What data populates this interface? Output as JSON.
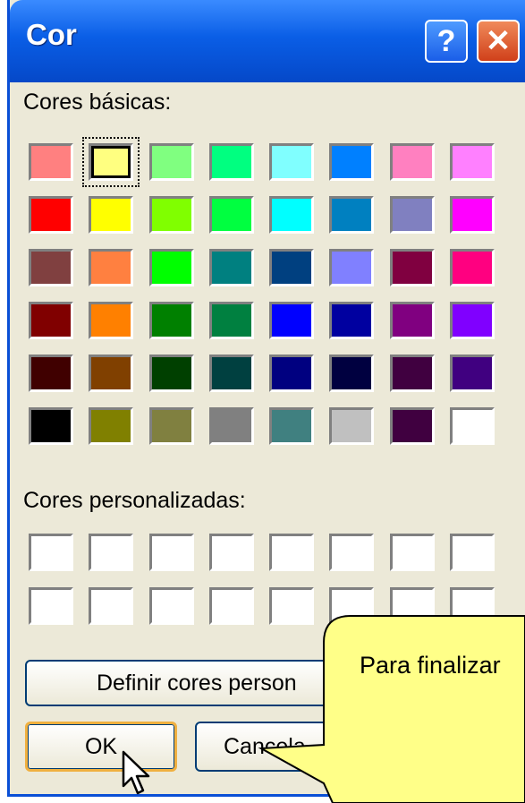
{
  "window": {
    "title": "Cor",
    "help_glyph": "?",
    "close_glyph": "✕"
  },
  "basic_colors": {
    "label": "Cores básicas:",
    "selected_index": 1,
    "swatches": [
      "#ff8080",
      "#ffff80",
      "#80ff80",
      "#00ff80",
      "#80ffff",
      "#0080ff",
      "#ff80c0",
      "#ff80ff",
      "#ff0000",
      "#ffff00",
      "#80ff00",
      "#00ff40",
      "#00ffff",
      "#0080c0",
      "#8080c0",
      "#ff00ff",
      "#804040",
      "#ff8040",
      "#00ff00",
      "#008080",
      "#004080",
      "#8080ff",
      "#800040",
      "#ff0080",
      "#800000",
      "#ff8000",
      "#008000",
      "#008040",
      "#0000ff",
      "#0000a0",
      "#800080",
      "#8000ff",
      "#400000",
      "#804000",
      "#004000",
      "#004040",
      "#000080",
      "#000040",
      "#400040",
      "#400080",
      "#000000",
      "#808000",
      "#808040",
      "#808080",
      "#408080",
      "#c0c0c0",
      "#400040",
      "#ffffff"
    ]
  },
  "custom_colors": {
    "label": "Cores personalizadas:",
    "swatches": [
      "#ffffff",
      "#ffffff",
      "#ffffff",
      "#ffffff",
      "#ffffff",
      "#ffffff",
      "#ffffff",
      "#ffffff",
      "#ffffff",
      "#ffffff",
      "#ffffff",
      "#ffffff",
      "#ffffff",
      "#ffffff",
      "#ffffff",
      "#ffffff"
    ]
  },
  "buttons": {
    "define_label": "Definir cores person",
    "ok_label": "OK",
    "cancel_label": "Cancela"
  },
  "tooltip": {
    "text": "Para finalizar"
  },
  "colors": {
    "titlebar": "#0a5ee6",
    "dialog_bg": "#ece9d8",
    "balloon": "#ffff88"
  }
}
